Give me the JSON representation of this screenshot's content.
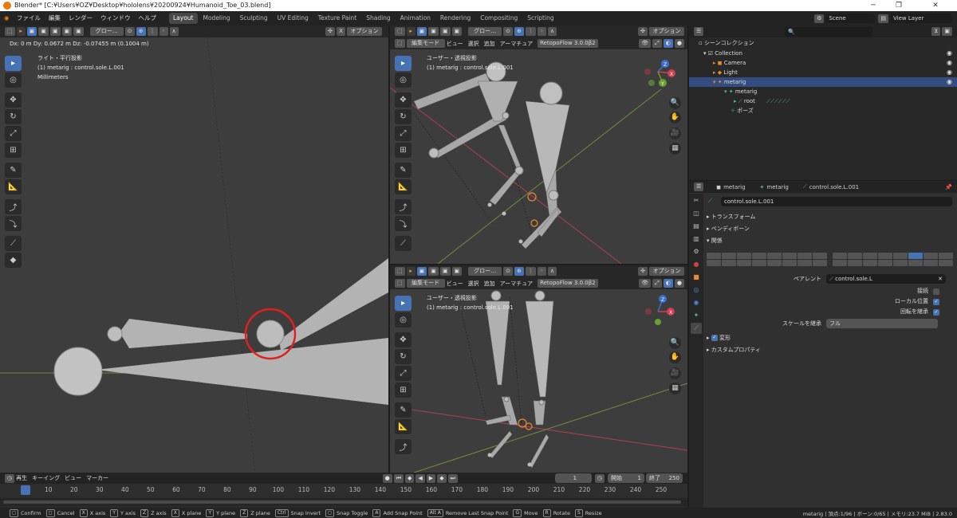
{
  "window": {
    "title": "Blender* [C:¥Users¥OZ¥Desktop¥hololens¥20200924¥Humanoid_Toe_03.blend]",
    "min": "─",
    "max": "❐",
    "close": "✕"
  },
  "menu": [
    "ファイル",
    "編集",
    "レンダー",
    "ウィンドウ",
    "ヘルプ"
  ],
  "workspaces": [
    "Layout",
    "Modeling",
    "Sculpting",
    "UV Editing",
    "Texture Paint",
    "Shading",
    "Animation",
    "Rendering",
    "Compositing",
    "Scripting"
  ],
  "active_workspace": "Layout",
  "scene": {
    "name": "Scene",
    "view_layer": "View Layer"
  },
  "left_viewport": {
    "transform_status": "Dx: 0 m   Dy: 0.0672 m   Dz: -0.07455 m (0.1004 m)",
    "overlay_line1": "ライト・平行投影",
    "overlay_line2": "(1) metarig : control.sole.L.001",
    "overlay_line3": "Millimeters",
    "transform_orientation": "グロー…",
    "options": "オプション"
  },
  "right_viewports": {
    "mode": "編集モード",
    "menus": [
      "ビュー",
      "選択",
      "追加",
      "アーマチュア"
    ],
    "addon": "RetopoFlow 3.0.0β2",
    "transform_orientation": "グロー…",
    "options": "オプション",
    "overlay_line1": "ユーザー・透視投影",
    "overlay_line2": "(1) metarig : control.sole.L.001"
  },
  "axis_labels": {
    "x": "X",
    "y": "Y",
    "z": "Z"
  },
  "outliner": {
    "search_placeholder": "",
    "scene_collection": "シーンコレクション",
    "items": [
      {
        "label": "Collection",
        "indent": 1
      },
      {
        "label": "Camera",
        "indent": 2
      },
      {
        "label": "Light",
        "indent": 2
      },
      {
        "label": "metarig",
        "indent": 2
      },
      {
        "label": "metarig",
        "indent": 3
      },
      {
        "label": "root",
        "indent": 4
      },
      {
        "label": "ポーズ",
        "indent": 3
      }
    ]
  },
  "properties": {
    "breadcrumb": [
      "metarig",
      "metarig",
      "control.sole.L.001"
    ],
    "bone_name": "control.sole.L.001",
    "panels": {
      "transform": "トランスフォーム",
      "bendy": "ベンディボーン",
      "relations": "関係",
      "deform": "変形",
      "custom": "カスタムプロパティ"
    },
    "parent_label": "ペアレント",
    "parent_value": "control.sole.L",
    "connected": "接続",
    "local_location": "ローカル位置",
    "inherit_rotation": "回転を継承",
    "inherit_scale_label": "スケールを継承",
    "inherit_scale_value": "フル"
  },
  "timeline": {
    "menus": [
      "再生",
      "キーイング",
      "ビュー",
      "マーカー"
    ],
    "current_frame": "1",
    "start_label": "開始",
    "start": "1",
    "end_label": "終了",
    "end": "250",
    "ticks": [
      "1",
      "10",
      "20",
      "30",
      "40",
      "50",
      "60",
      "70",
      "80",
      "90",
      "100",
      "110",
      "120",
      "130",
      "140",
      "150",
      "160",
      "170",
      "180",
      "190",
      "200",
      "210",
      "220",
      "230",
      "240",
      "250"
    ]
  },
  "statusbar": {
    "items": [
      {
        "key": "",
        "label": "Confirm"
      },
      {
        "key": "",
        "label": "Cancel"
      },
      {
        "key": "X",
        "label": "X axis"
      },
      {
        "key": "Y",
        "label": "Y axis"
      },
      {
        "key": "Z",
        "label": "Z axis"
      },
      {
        "key": "X",
        "label": "X plane"
      },
      {
        "key": "Y",
        "label": "Y plane"
      },
      {
        "key": "Z",
        "label": "Z plane"
      },
      {
        "key": "Ctrl",
        "label": "Snap Invert"
      },
      {
        "key": "",
        "label": "Snap Toggle"
      },
      {
        "key": "A",
        "label": "Add Snap Point"
      },
      {
        "key": "Alt A",
        "label": "Remove Last Snap Point"
      },
      {
        "key": "G",
        "label": "Move"
      },
      {
        "key": "R",
        "label": "Rotate"
      },
      {
        "key": "S",
        "label": "Resize"
      }
    ],
    "stats": "metarig | 頂点:1/96 | ボーン:0/65 | メモリ:23.7 MiB | 2.83.0"
  },
  "colors": {
    "accent": "#4772b3",
    "selection_ring": "#e02020",
    "bone": "#b0b0b0",
    "x_axis": "#c04050",
    "y_axis": "#70a030"
  }
}
